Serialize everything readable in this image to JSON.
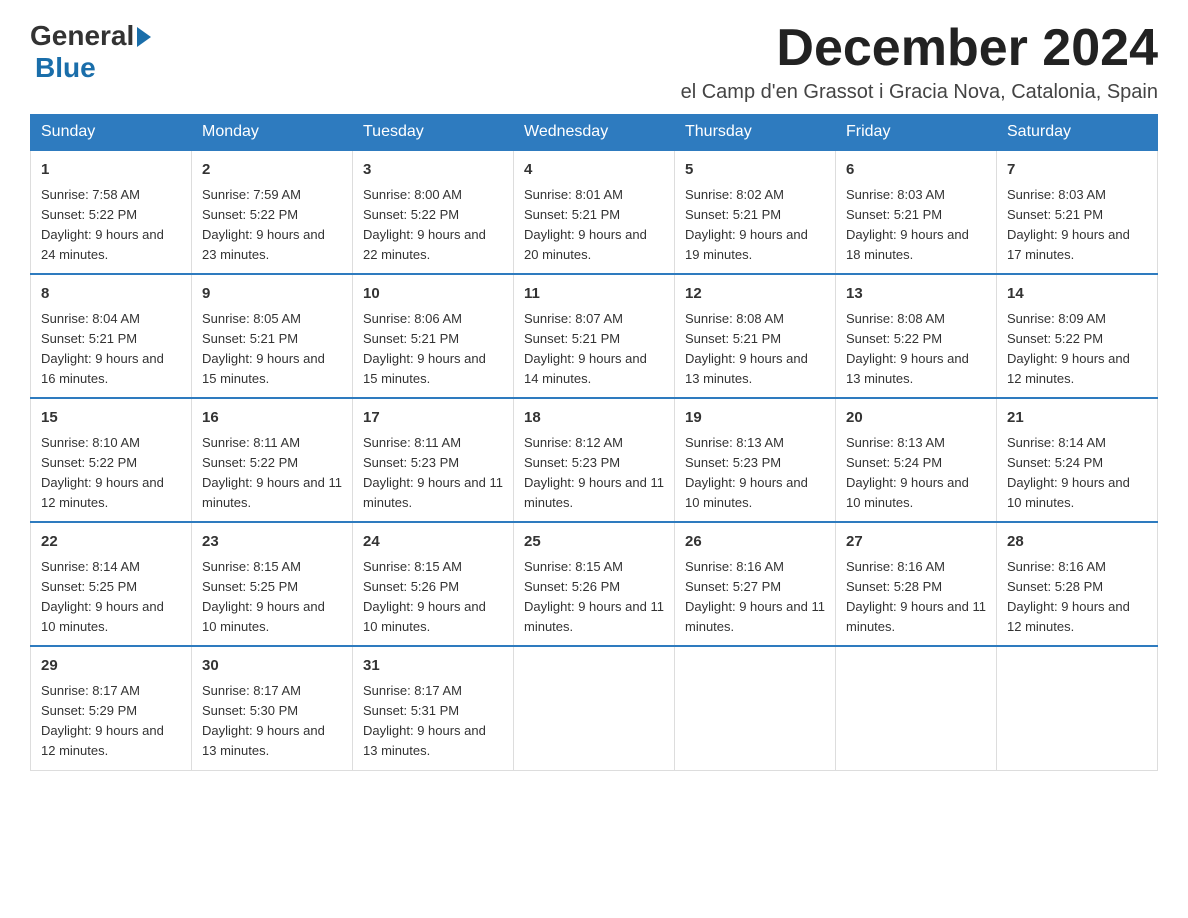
{
  "logo": {
    "text_general": "General",
    "text_blue": "Blue"
  },
  "header": {
    "title": "December 2024",
    "subtitle": "el Camp d'en Grassot i Gracia Nova, Catalonia, Spain"
  },
  "weekdays": [
    "Sunday",
    "Monday",
    "Tuesday",
    "Wednesday",
    "Thursday",
    "Friday",
    "Saturday"
  ],
  "weeks": [
    [
      {
        "day": "1",
        "sunrise": "7:58 AM",
        "sunset": "5:22 PM",
        "daylight": "9 hours and 24 minutes."
      },
      {
        "day": "2",
        "sunrise": "7:59 AM",
        "sunset": "5:22 PM",
        "daylight": "9 hours and 23 minutes."
      },
      {
        "day": "3",
        "sunrise": "8:00 AM",
        "sunset": "5:22 PM",
        "daylight": "9 hours and 22 minutes."
      },
      {
        "day": "4",
        "sunrise": "8:01 AM",
        "sunset": "5:21 PM",
        "daylight": "9 hours and 20 minutes."
      },
      {
        "day": "5",
        "sunrise": "8:02 AM",
        "sunset": "5:21 PM",
        "daylight": "9 hours and 19 minutes."
      },
      {
        "day": "6",
        "sunrise": "8:03 AM",
        "sunset": "5:21 PM",
        "daylight": "9 hours and 18 minutes."
      },
      {
        "day": "7",
        "sunrise": "8:03 AM",
        "sunset": "5:21 PM",
        "daylight": "9 hours and 17 minutes."
      }
    ],
    [
      {
        "day": "8",
        "sunrise": "8:04 AM",
        "sunset": "5:21 PM",
        "daylight": "9 hours and 16 minutes."
      },
      {
        "day": "9",
        "sunrise": "8:05 AM",
        "sunset": "5:21 PM",
        "daylight": "9 hours and 15 minutes."
      },
      {
        "day": "10",
        "sunrise": "8:06 AM",
        "sunset": "5:21 PM",
        "daylight": "9 hours and 15 minutes."
      },
      {
        "day": "11",
        "sunrise": "8:07 AM",
        "sunset": "5:21 PM",
        "daylight": "9 hours and 14 minutes."
      },
      {
        "day": "12",
        "sunrise": "8:08 AM",
        "sunset": "5:21 PM",
        "daylight": "9 hours and 13 minutes."
      },
      {
        "day": "13",
        "sunrise": "8:08 AM",
        "sunset": "5:22 PM",
        "daylight": "9 hours and 13 minutes."
      },
      {
        "day": "14",
        "sunrise": "8:09 AM",
        "sunset": "5:22 PM",
        "daylight": "9 hours and 12 minutes."
      }
    ],
    [
      {
        "day": "15",
        "sunrise": "8:10 AM",
        "sunset": "5:22 PM",
        "daylight": "9 hours and 12 minutes."
      },
      {
        "day": "16",
        "sunrise": "8:11 AM",
        "sunset": "5:22 PM",
        "daylight": "9 hours and 11 minutes."
      },
      {
        "day": "17",
        "sunrise": "8:11 AM",
        "sunset": "5:23 PM",
        "daylight": "9 hours and 11 minutes."
      },
      {
        "day": "18",
        "sunrise": "8:12 AM",
        "sunset": "5:23 PM",
        "daylight": "9 hours and 11 minutes."
      },
      {
        "day": "19",
        "sunrise": "8:13 AM",
        "sunset": "5:23 PM",
        "daylight": "9 hours and 10 minutes."
      },
      {
        "day": "20",
        "sunrise": "8:13 AM",
        "sunset": "5:24 PM",
        "daylight": "9 hours and 10 minutes."
      },
      {
        "day": "21",
        "sunrise": "8:14 AM",
        "sunset": "5:24 PM",
        "daylight": "9 hours and 10 minutes."
      }
    ],
    [
      {
        "day": "22",
        "sunrise": "8:14 AM",
        "sunset": "5:25 PM",
        "daylight": "9 hours and 10 minutes."
      },
      {
        "day": "23",
        "sunrise": "8:15 AM",
        "sunset": "5:25 PM",
        "daylight": "9 hours and 10 minutes."
      },
      {
        "day": "24",
        "sunrise": "8:15 AM",
        "sunset": "5:26 PM",
        "daylight": "9 hours and 10 minutes."
      },
      {
        "day": "25",
        "sunrise": "8:15 AM",
        "sunset": "5:26 PM",
        "daylight": "9 hours and 11 minutes."
      },
      {
        "day": "26",
        "sunrise": "8:16 AM",
        "sunset": "5:27 PM",
        "daylight": "9 hours and 11 minutes."
      },
      {
        "day": "27",
        "sunrise": "8:16 AM",
        "sunset": "5:28 PM",
        "daylight": "9 hours and 11 minutes."
      },
      {
        "day": "28",
        "sunrise": "8:16 AM",
        "sunset": "5:28 PM",
        "daylight": "9 hours and 12 minutes."
      }
    ],
    [
      {
        "day": "29",
        "sunrise": "8:17 AM",
        "sunset": "5:29 PM",
        "daylight": "9 hours and 12 minutes."
      },
      {
        "day": "30",
        "sunrise": "8:17 AM",
        "sunset": "5:30 PM",
        "daylight": "9 hours and 13 minutes."
      },
      {
        "day": "31",
        "sunrise": "8:17 AM",
        "sunset": "5:31 PM",
        "daylight": "9 hours and 13 minutes."
      },
      null,
      null,
      null,
      null
    ]
  ]
}
